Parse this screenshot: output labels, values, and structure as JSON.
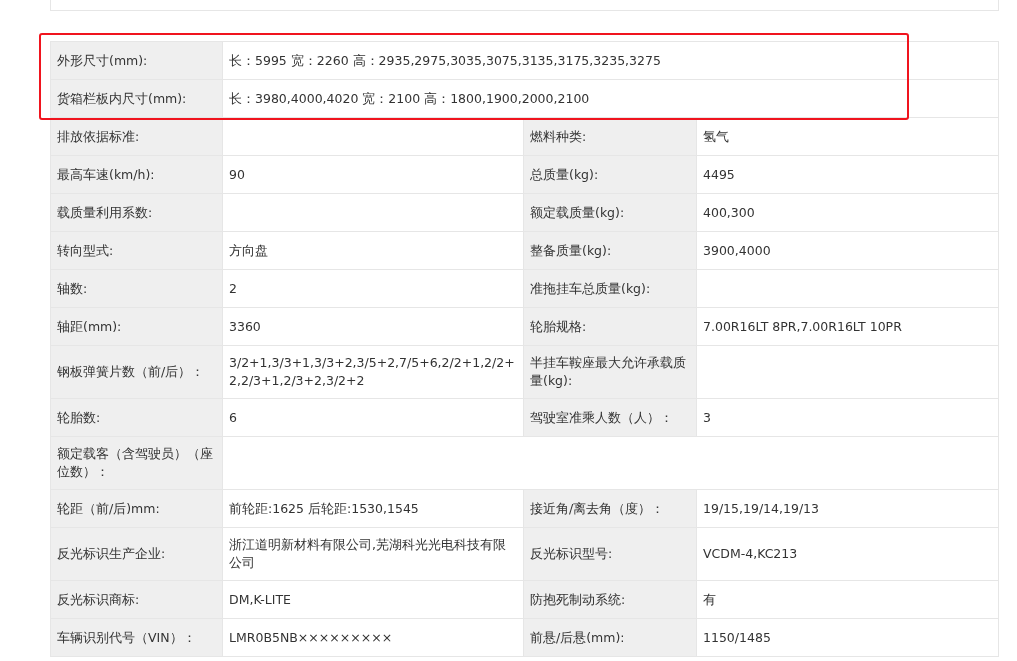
{
  "table": {
    "highlighted_rows": [
      {
        "cells": [
          {
            "label": "外形尺寸(mm):",
            "value": "长：5995 宽：2260 高：2935,2975,3035,3075,3135,3175,3235,3275"
          }
        ]
      },
      {
        "cells": [
          {
            "label": "货箱栏板内尺寸(mm):",
            "value": "长：3980,4000,4020 宽：2100 高：1800,1900,2000,2100"
          }
        ]
      }
    ],
    "rows": [
      {
        "cells": [
          {
            "label": "排放依据标准:"
          },
          {
            "label": "燃料种类:",
            "value": "氢气"
          }
        ]
      },
      {
        "cells": [
          {
            "label": "最高车速(km/h):",
            "value": "90"
          },
          {
            "label": "总质量(kg):",
            "value": "4495"
          }
        ]
      },
      {
        "cells": [
          {
            "label": "载质量利用系数:"
          },
          {
            "label": "额定载质量(kg):",
            "value": "400,300"
          }
        ]
      },
      {
        "cells": [
          {
            "label": "转向型式:",
            "value": "方向盘"
          },
          {
            "label": "整备质量(kg):",
            "value": "3900,4000"
          }
        ]
      },
      {
        "cells": [
          {
            "label": "轴数:",
            "value": "2"
          },
          {
            "label": "准拖挂车总质量(kg):"
          }
        ]
      },
      {
        "cells": [
          {
            "label": "轴距(mm):",
            "value": "3360"
          },
          {
            "label": "轮胎规格:",
            "value": "7.00R16LT 8PR,7.00R16LT 10PR"
          }
        ]
      },
      {
        "cells": [
          {
            "label": "钢板弹簧片数（前/后）：",
            "value": "3/2+1,3/3+1,3/3+2,3/5+2,7/5+6,2/2+1,2/2+2,2/3+1,2/3+2,3/2+2"
          },
          {
            "label": "半挂车鞍座最大允许承载质量(kg):"
          }
        ]
      },
      {
        "cells": [
          {
            "label": "轮胎数:",
            "value": "6"
          },
          {
            "label": "驾驶室准乘人数（人）：",
            "value": "3"
          }
        ]
      },
      {
        "cells": [
          {
            "label": "额定载客（含驾驶员）（座位数）："
          }
        ]
      },
      {
        "cells": [
          {
            "label": "轮距（前/后)mm:",
            "value": "前轮距:1625 后轮距:1530,1545"
          },
          {
            "label": "接近角/离去角（度）：",
            "value": "19/15,19/14,19/13"
          }
        ]
      },
      {
        "cells": [
          {
            "label": "反光标识生产企业:",
            "value": "浙江道明新材料有限公司,芜湖科光光电科技有限公司"
          },
          {
            "label": "反光标识型号:",
            "value": "VCDM-4,KC213"
          }
        ]
      },
      {
        "cells": [
          {
            "label": "反光标识商标:",
            "value": "DM,K-LITE"
          },
          {
            "label": "防抱死制动系统:",
            "value": "有"
          }
        ]
      },
      {
        "cells": [
          {
            "label": "车辆识别代号（VIN）：",
            "value": "LMR0B5NB×××××××××"
          },
          {
            "label": "前悬/后悬(mm):",
            "value": "1150/1485"
          }
        ]
      }
    ]
  }
}
